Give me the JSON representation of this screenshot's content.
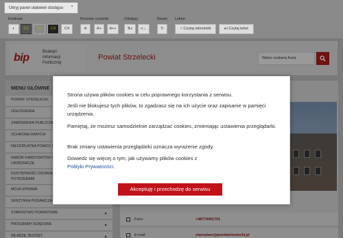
{
  "a11y": {
    "toggle_label": "Ukryj panel ułatwień dostępu",
    "groups": {
      "contrast": "Kontrast:",
      "font_size": "Rozmiar czcionki:",
      "spacing": "Odstępy:",
      "reset": "Reset:",
      "reader": "Lektor:"
    },
    "contrast_buttons": [
      "C1",
      "C2",
      "C3",
      "C4"
    ],
    "font_buttons": [
      "A",
      "A+",
      "A++"
    ],
    "reader_buttons": [
      "Czytaj odnośniki",
      "Czytaj tekst"
    ]
  },
  "header": {
    "bip_logo": "bip",
    "bip_lines": [
      "Biuletyn",
      "Informacji",
      "Publicznej"
    ],
    "county_name": "Powiat Strzelecki",
    "search_placeholder": "Wpisz szukaną frazę"
  },
  "sidebar": {
    "title": "MENU GŁÓWNE",
    "items": [
      "POWIAT STRZELECKI",
      "OGŁOSZENIA",
      "ZAMÓWIENIA PUBLICZNE",
      "OCHRONA DANYCH",
      "NIEODPŁATNA POMOC PRAWNA",
      "NABÓR KANDYDATÓW NA WOLNE STANOWISKA URZĘDNICZE",
      "DOSTĘPNOŚĆ OSOBOM ZE SZCZEGÓLNYMI POTRZEBAMI",
      "MOJA SPRAWA",
      "SKRZYNKA PODAWCZA",
      "STAROSTWO POWIATOWE",
      "PROGRAMY RZĄDOWE",
      "WŁADZE, BUDŻET"
    ]
  },
  "contact": {
    "fax_label": "Faks:",
    "fax_value": "+48774401701",
    "email_label": "E-mail:",
    "email_value": "starostwo@powiatstrzelecki.pl"
  },
  "cookie_modal": {
    "p1": "Strona używa plików cookies w celu poprawnego korzystania z serwisu.",
    "p2": "Jeśli nie blokujesz tych plików, to zgadzasz się na ich użycie oraz zapisanie w pamięci urządzenia.",
    "p3": "Pamiętaj, że możesz samodzielnie zarządzać cookies, zmieniając ustawienia przeglądarki.",
    "p4": "Brak zmiany ustawienia przeglądarki oznacza wyrażenie zgody.",
    "p5": "Dowiedz się więcej o tym, jak używamy plików cookies z",
    "policy_link": "Polityki Prywatności",
    "p5_end": ".",
    "accept_button": "Akceptuję i przechodzę do serwisu"
  }
}
